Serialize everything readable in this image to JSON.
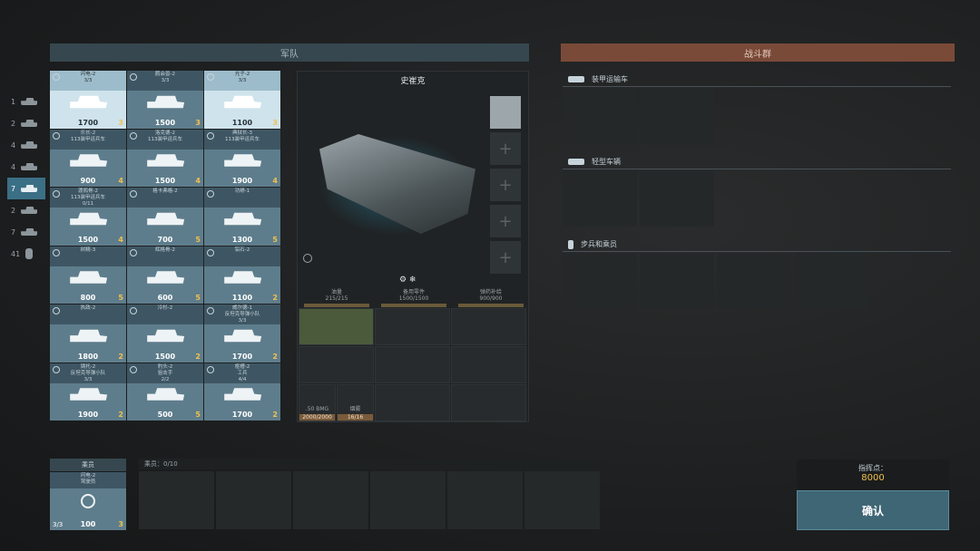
{
  "header": {
    "army_title": "军队",
    "battlegroup_title": "战斗群"
  },
  "rail": {
    "items": [
      {
        "num": "1",
        "icon": "helicopter-icon"
      },
      {
        "num": "2",
        "icon": "tank-icon"
      },
      {
        "num": "4",
        "icon": "tank-icon"
      },
      {
        "num": "4",
        "icon": "tank-icon"
      },
      {
        "num": "7",
        "icon": "apc-icon"
      },
      {
        "num": "2",
        "icon": "tank-icon"
      },
      {
        "num": "7",
        "icon": "light-vehicle-icon"
      },
      {
        "num": "41",
        "icon": "infantry-icon"
      }
    ]
  },
  "units": [
    {
      "name": "闪电-2",
      "sub": "",
      "avail": "3/3",
      "cost": "1700",
      "count": "3",
      "sel": true
    },
    {
      "name": "鹳会兽-2",
      "sub": "",
      "avail": "3/3",
      "cost": "1500",
      "count": "3"
    },
    {
      "name": "光子-2",
      "sub": "",
      "avail": "3/3",
      "cost": "1100",
      "count": "3",
      "sel": true
    },
    {
      "name": "乐长-2",
      "sub": "113装甲运兵车",
      "avail": "",
      "cost": "900",
      "count": "4"
    },
    {
      "name": "洛克德-2",
      "sub": "113装甲运兵车",
      "avail": "",
      "cost": "1500",
      "count": "4"
    },
    {
      "name": "典狱长-3",
      "sub": "113装甲运兵车",
      "avail": "",
      "cost": "1900",
      "count": "4"
    },
    {
      "name": "渡鸦骨-2",
      "sub": "113装甲运兵车",
      "avail": "0/11",
      "cost": "1500",
      "count": "4"
    },
    {
      "name": "格卡弗格-2",
      "sub": "",
      "avail": "",
      "cost": "700",
      "count": "5"
    },
    {
      "name": "功绩-1",
      "sub": "",
      "avail": "",
      "cost": "1300",
      "count": "5"
    },
    {
      "name": "树精-3",
      "sub": "",
      "avail": "",
      "cost": "800",
      "count": "5"
    },
    {
      "name": "辉格骨-2",
      "sub": "",
      "avail": "",
      "cost": "600",
      "count": "5"
    },
    {
      "name": "铅石-2",
      "sub": "",
      "avail": "",
      "cost": "1100",
      "count": "2"
    },
    {
      "name": "执政-2",
      "sub": "",
      "avail": "",
      "cost": "1800",
      "count": "2"
    },
    {
      "name": "冷杉-2",
      "sub": "",
      "avail": "",
      "cost": "1500",
      "count": "2"
    },
    {
      "name": "威尔德-1",
      "sub": "反坦克导弹小队",
      "avail": "3/3",
      "cost": "1700",
      "count": "2"
    },
    {
      "name": "铸托-2",
      "sub": "反坦克导弹小队",
      "avail": "3/3",
      "cost": "1900",
      "count": "2"
    },
    {
      "name": "豹头-2",
      "sub": "狙击手",
      "avail": "2/2",
      "cost": "500",
      "count": "5"
    },
    {
      "name": "枢槽-2",
      "sub": "工兵",
      "avail": "4/4",
      "cost": "1700",
      "count": "2"
    }
  ],
  "vehicle": {
    "name": "史崔克",
    "stats": [
      {
        "label": "油量",
        "value": "215/215"
      },
      {
        "label": "备用零件",
        "value": "1500/1500"
      },
      {
        "label": "弹药补给",
        "value": "900/900"
      }
    ],
    "weapon": {
      "ammo1_name": ".50 BMG",
      "ammo1": "2000/2000",
      "ammo2_name": "烟雾",
      "ammo2": "16/16"
    }
  },
  "battlegroup": {
    "sections": [
      {
        "title": "装甲运输车",
        "icon": "apc-icon"
      },
      {
        "title": "轻型车辆",
        "icon": "light-vehicle-icon"
      },
      {
        "title": "步兵和乘员",
        "icon": "infantry-icon"
      }
    ]
  },
  "crew": {
    "tab": "乘员",
    "bar": "乘员：0/10",
    "card": {
      "name": "闪电-2",
      "sub": "驾驶员",
      "avail": "3/3",
      "cost": "100",
      "count": "3"
    }
  },
  "command": {
    "label": "指挥点：",
    "value": "8000",
    "confirm": "确认"
  },
  "colors": {
    "accent": "#3e6675",
    "battlegroup": "#7a4a38",
    "gold": "#f2c14e"
  }
}
